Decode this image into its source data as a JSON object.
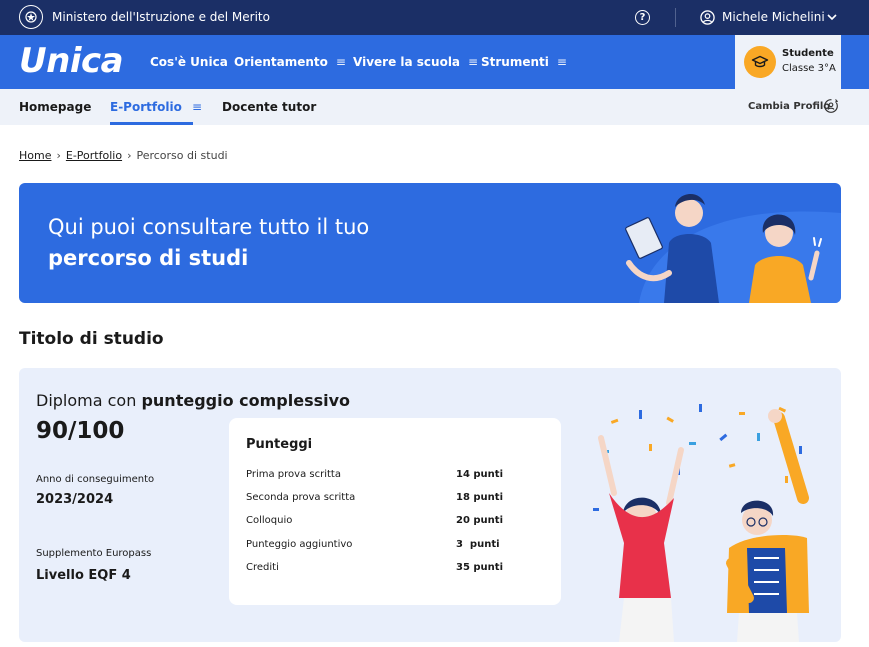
{
  "topbar": {
    "ministry": "Ministero dell'Istruzione e del Merito",
    "help_symbol": "?",
    "user_name": "Michele Michelini"
  },
  "mainnav": {
    "logo": "Unica",
    "items": [
      {
        "label": "Cos'è Unica",
        "has_menu": false
      },
      {
        "label": "Orientamento",
        "has_menu": true
      },
      {
        "label": "Vivere la scuola",
        "has_menu": true
      },
      {
        "label": "Strumenti",
        "has_menu": true
      }
    ],
    "menu_glyph": "≡",
    "profile": {
      "role": "Studente",
      "class": "Classe 3°A"
    }
  },
  "subnav": {
    "items": [
      "Homepage",
      "E-Portfolio",
      "Docente tutor"
    ],
    "active": "E-Portfolio",
    "menu_glyph": "≡",
    "change_profile": "Cambia Profilo"
  },
  "breadcrumb": {
    "home": "Home",
    "portfolio": "E-Portfolio",
    "current": "Percorso di studi",
    "separator": "›"
  },
  "hero": {
    "line1": "Qui puoi consultare tutto il tuo",
    "line2": "percorso di studi"
  },
  "section_title": "Titolo di studio",
  "diploma": {
    "title_prefix": "Diploma con",
    "title_bold": "punteggio complessivo",
    "score": "90/100",
    "year_label": "Anno di conseguimento",
    "year_value": "2023/2024",
    "europass_label": "Supplemento Europass",
    "europass_value": "Livello EQF 4",
    "points": {
      "heading": "Punteggi",
      "rows": [
        {
          "label": "Prima prova scritta",
          "value": "14 punti"
        },
        {
          "label": "Seconda prova scritta",
          "value": "18 punti"
        },
        {
          "label": "Colloquio",
          "value": "20 punti"
        },
        {
          "label": "Punteggio aggiuntivo",
          "value": "3  punti"
        },
        {
          "label": "Crediti",
          "value": "35 punti"
        }
      ]
    }
  },
  "colors": {
    "topbar": "#1b2f66",
    "primary": "#2d6be0",
    "light_bg": "#eef2f9",
    "card_bg": "#e9effb",
    "accent": "#f9a825"
  }
}
